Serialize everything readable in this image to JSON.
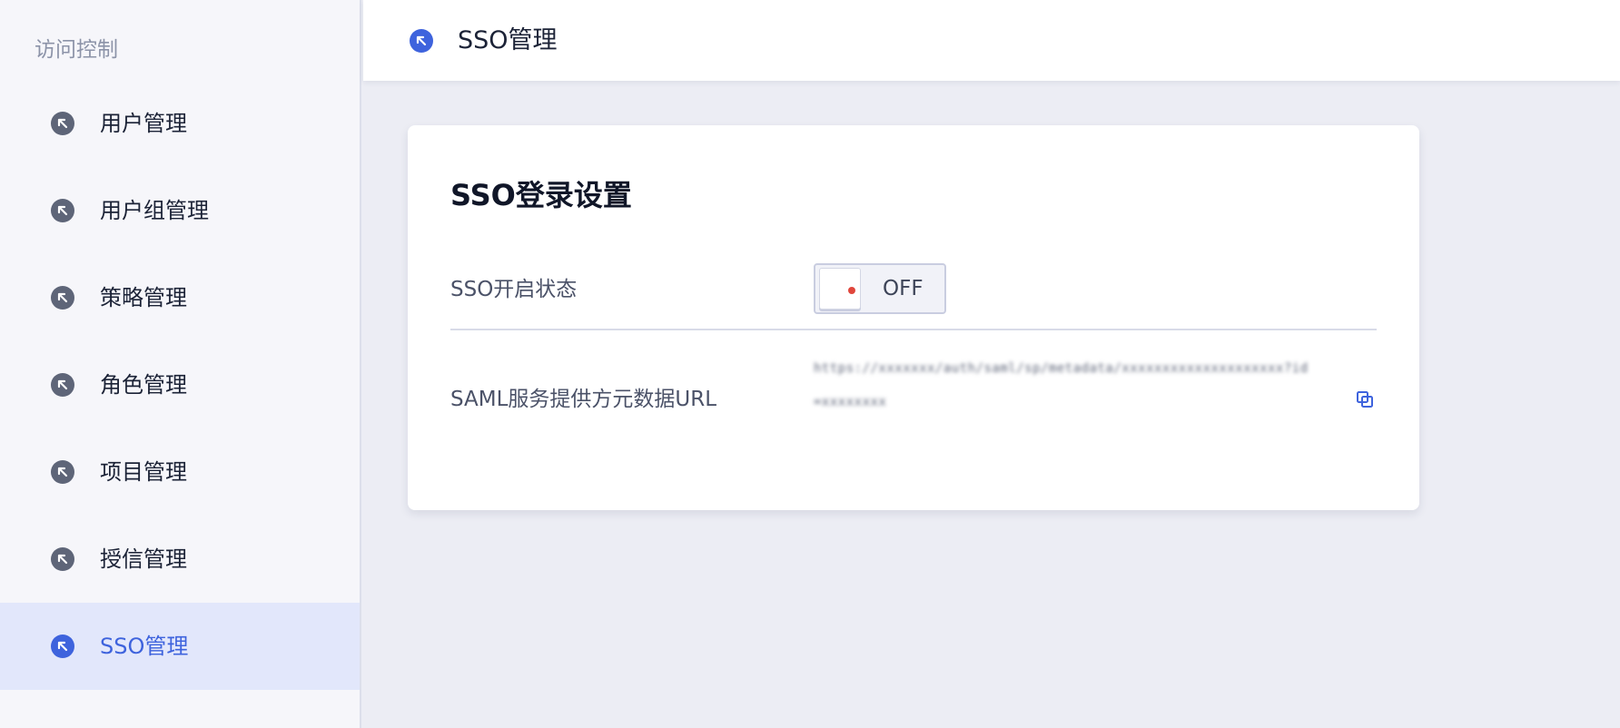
{
  "sidebar": {
    "title": "访问控制",
    "items": [
      {
        "label": "用户管理",
        "icon": "arrow-up-left-circle-icon"
      },
      {
        "label": "用户组管理",
        "icon": "arrow-up-left-circle-icon"
      },
      {
        "label": "策略管理",
        "icon": "arrow-up-left-circle-icon"
      },
      {
        "label": "角色管理",
        "icon": "arrow-up-left-circle-icon"
      },
      {
        "label": "项目管理",
        "icon": "arrow-up-left-circle-icon"
      },
      {
        "label": "授信管理",
        "icon": "arrow-up-left-circle-icon"
      },
      {
        "label": "SSO管理",
        "icon": "arrow-up-left-circle-icon",
        "active": true
      }
    ]
  },
  "header": {
    "title": "SSO管理",
    "icon": "arrow-up-left-circle-icon"
  },
  "card": {
    "title": "SSO登录设置",
    "sso_status": {
      "label": "SSO开启状态",
      "toggle_text": "OFF",
      "enabled": false
    },
    "saml_url": {
      "label": "SAML服务提供方元数据URL",
      "value": "https://xxxxxxx/auth/saml/sp/metadata/xxxxxxxxxxxxxxxxxxxx?id=xxxxxxxx",
      "blurred": true,
      "copy_icon": "copy-icon"
    }
  },
  "colors": {
    "accent": "#3e63dd",
    "toggle_off_dot": "#e0463c",
    "page_background": "#ecedf4",
    "sidebar_background": "#f6f6fa",
    "active_item_background": "#e2e7fb"
  }
}
